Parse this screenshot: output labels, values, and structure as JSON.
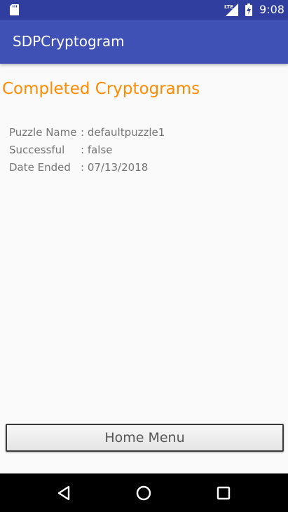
{
  "status_bar": {
    "time": "9:08",
    "network": "LTE",
    "icons": [
      "sd-card-icon",
      "lte-signal-icon",
      "battery-charging-icon"
    ]
  },
  "app_bar": {
    "title": "SDPCryptogram",
    "color": "#3f51b5",
    "status_color": "#303f9f"
  },
  "page": {
    "title": "Completed Cryptograms",
    "title_color": "#ff8c00"
  },
  "details": [
    {
      "label": "Puzzle Name",
      "value": ": defaultpuzzle1"
    },
    {
      "label": "Successful",
      "value": ": false"
    },
    {
      "label": "Date Ended",
      "value": ": 07/13/2018"
    }
  ],
  "home_button": {
    "label": "Home Menu"
  },
  "nav_bar": {
    "buttons": [
      "back-icon",
      "home-icon",
      "recents-icon"
    ]
  }
}
